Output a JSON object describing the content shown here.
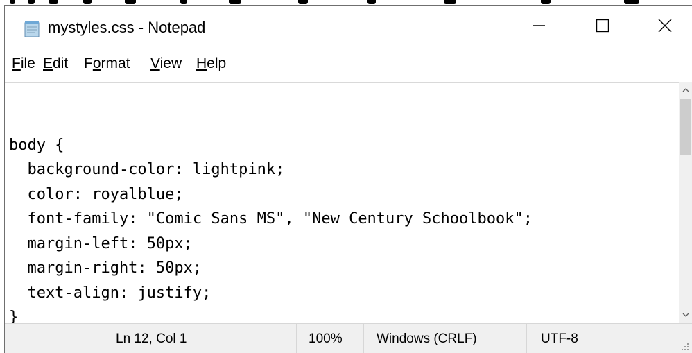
{
  "window": {
    "title": "mystyles.css - Notepad"
  },
  "menu": {
    "items": [
      {
        "pre": "",
        "key": "F",
        "post": "ile"
      },
      {
        "pre": "",
        "key": "E",
        "post": "dit"
      },
      {
        "pre": "F",
        "key": "o",
        "post": "rmat"
      },
      {
        "pre": "",
        "key": "V",
        "post": "iew"
      },
      {
        "pre": "",
        "key": "H",
        "post": "elp"
      }
    ]
  },
  "editor": {
    "lines": [
      "",
      "body {",
      "  background-color: lightpink;",
      "  color: royalblue;",
      "  font-family: \"Comic Sans MS\", \"New Century Schoolbook\";",
      "  margin-left: 50px;",
      "  margin-right: 50px;",
      "  text-align: justify;",
      "}"
    ]
  },
  "status": {
    "position": "Ln 12, Col 1",
    "zoom": "100%",
    "line_ending": "Windows (CRLF)",
    "encoding": "UTF-8"
  },
  "icons": {
    "app": "notepad-icon",
    "minimize": "minimize-icon",
    "maximize": "maximize-icon",
    "close": "close-icon"
  },
  "colors": {
    "title_bg": "#ffffff",
    "status_bg": "#f0f0f0",
    "scrollbar_bg": "#f0f0f0",
    "scroll_thumb": "#cdcdcd"
  }
}
